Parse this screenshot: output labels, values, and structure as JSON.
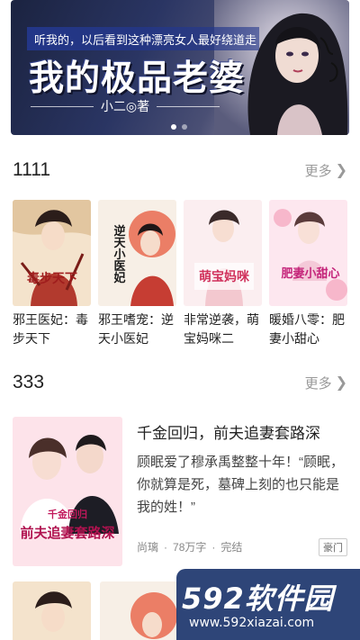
{
  "banner": {
    "tagline": "听我的，以后看到这种漂亮女人最好绕道走",
    "title": "我的极品老婆",
    "author": "小二◎著",
    "page_count": 2,
    "active_page": 1
  },
  "section1": {
    "title": "1111",
    "more": "更多",
    "books": [
      {
        "name": "邪王医妃：毒步天下",
        "cover_text": "毒步天下"
      },
      {
        "name": "邪王嗜宠：逆天小医妃",
        "cover_text": "逆天小医妃"
      },
      {
        "name": "非常逆袭，萌宝妈咪二",
        "cover_text": "萌宝妈咪"
      },
      {
        "name": "暖婚八零：肥妻小甜心",
        "cover_text": "肥妻小甜心"
      }
    ]
  },
  "section2": {
    "title": "333",
    "more": "更多",
    "feature": {
      "title": "千金回归，前夫追妻套路深",
      "description": "顾眠爱了穆承禹整整十年！“顾眠，你就算是死，墓碑上刻的也只能是我的姓！”",
      "author": "尚璃",
      "words": "78万字",
      "status": "完结",
      "tag": "豪门",
      "cover_text": "前夫追妻套路深",
      "cover_subtext": "千金回归"
    }
  },
  "watermark": {
    "logo": "592软件园",
    "url": "www.592xiazai.com"
  }
}
